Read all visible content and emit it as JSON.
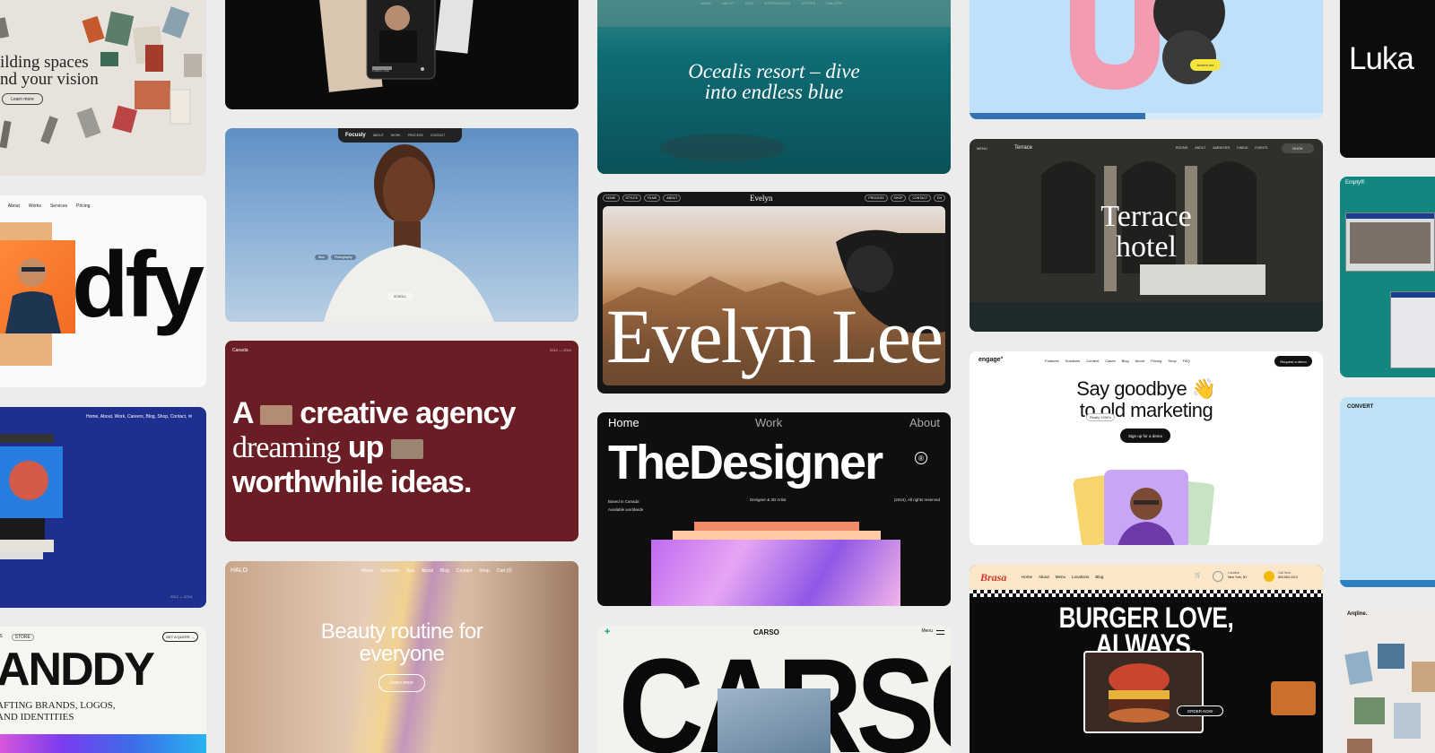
{
  "cards": {
    "spaces": {
      "headline_1": "ilding spaces",
      "headline_2": "nd your vision",
      "button": "Learn more"
    },
    "dfy": {
      "nav": [
        "e",
        "About",
        "Works",
        "Services",
        "Pricing"
      ],
      "word": "dfy"
    },
    "portfolio_blue": {
      "nav": "Home, About, Work, Careers, Blog, Shop, Contact, ✉",
      "year": "2012 — 2024"
    },
    "andy": {
      "nav": [
        "ES",
        "STORE"
      ],
      "cta": "GET A QUOTE →",
      "word": "ANDDY",
      "line1": "AFTING BRANDS, LOGOS,",
      "line2": "AND IDENTITIES"
    },
    "dark_phone": {
      "caption": "Direct Link"
    },
    "focusly": {
      "brand": "Focusly",
      "nav": [
        "ABOUT",
        "WORK",
        "PROCESS",
        "CONTACT"
      ],
      "tags": [
        "Bios",
        "Photography"
      ],
      "scroll": "SCROLL"
    },
    "canada": {
      "brand": "Canada",
      "years": "2012 — 2024",
      "line1a": "A",
      "line1b": "creative agency",
      "line2a": "dreaming",
      "line2b": "up",
      "line3": "worthwhile ideas."
    },
    "halo": {
      "brand": "HALO",
      "nav": [
        "Home",
        "Solutions",
        "Spa",
        "About",
        "Blog",
        "Contact",
        "Shop",
        "Cart (0)"
      ],
      "headline_1": "Beauty routine for",
      "headline_2": "everyone",
      "button": "Learn more"
    },
    "ocealis": {
      "nav": [
        "HOME",
        "ABOUT",
        "STAY",
        "EXPERIENCES",
        "OFFERS",
        "GALLERY"
      ],
      "headline_1": "Ocealis resort – dive",
      "headline_2": "into endless blue"
    },
    "evelyn": {
      "brand": "Evelyn",
      "nav_left": [
        "HOME",
        "STYLES",
        "FILMS",
        "ABOUT"
      ],
      "nav_right": [
        "PROCESS",
        "SHOP",
        "CONTACT",
        "EN"
      ],
      "name": "Evelyn Lee"
    },
    "designer": {
      "nav": [
        "Home",
        "Work",
        "About"
      ],
      "title": "TheDesigner",
      "meta_left_1": "Based in Canada",
      "meta_left_2": "Available worldwide",
      "meta_center": "Designer & 3D Artist",
      "meta_right": "(2024), All rights reserved"
    },
    "carso": {
      "brand": "CARSO",
      "menu": "Menu",
      "word": "CARSO"
    },
    "balloon": {
      "badge": "Accent me"
    },
    "terrace": {
      "menu": "MENU",
      "brand": "Terrace",
      "nav": [
        "ROOMS",
        "ABOUT",
        "AMENITIES",
        "DINING",
        "EVENTS"
      ],
      "book": "BOOK",
      "headline_1": "Terrace",
      "headline_2": "hotel"
    },
    "engage": {
      "brand": "engage°",
      "nav": [
        "Features",
        "Solutions",
        "Content",
        "Cases",
        "Blog",
        "About",
        "Pricing",
        "Shop",
        "FAQ"
      ],
      "cta": "Request a demo",
      "headline_1": "Say goodbye 👋",
      "headline_2": "to old marketing",
      "chip": "Really 1990's",
      "button": "Sign up for a demo"
    },
    "brasa": {
      "brand": "Brasa",
      "nav": [
        "Home",
        "About",
        "Menu",
        "Locations",
        "Blog"
      ],
      "location_label": "Location",
      "location": "New York, NY",
      "phone_label": "Call Now",
      "phone": "800-654-3210",
      "headline_1": "BURGER LOVE,",
      "headline_2": "ALWAYS.",
      "order": "ORDER NOW"
    },
    "luka": {
      "word": "Luka"
    },
    "empty": {
      "brand": "Empty®"
    },
    "convert": {
      "brand": "CONVERT"
    },
    "arqline": {
      "brand": "Arqline."
    }
  },
  "colors": {
    "background": "#ececec",
    "canada_red": "#6b1d25",
    "portfolio_blue": "#1e2f8f",
    "empty_teal": "#13877f"
  }
}
